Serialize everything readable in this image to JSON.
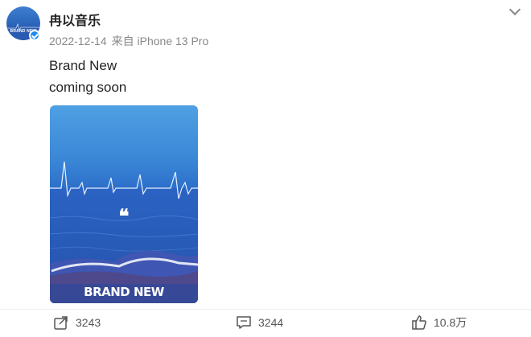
{
  "post": {
    "username": "冉以音乐",
    "date": "2022-12-14",
    "source": "来自 iPhone 13 Pro",
    "text_lines": [
      "Brand New",
      "coming soon"
    ],
    "image": {
      "quote": "❝",
      "caption": "BRAND NEW"
    }
  },
  "avatar": {
    "mini_text": "BRAND NEW"
  },
  "actions": {
    "repost_count": "3243",
    "comment_count": "3244",
    "like_count": "10.8万"
  },
  "icons": {
    "menu": "chevron-down-icon",
    "repost": "share-icon",
    "comment": "comment-icon",
    "like": "thumbs-up-icon",
    "verified": "verified-badge-icon"
  }
}
